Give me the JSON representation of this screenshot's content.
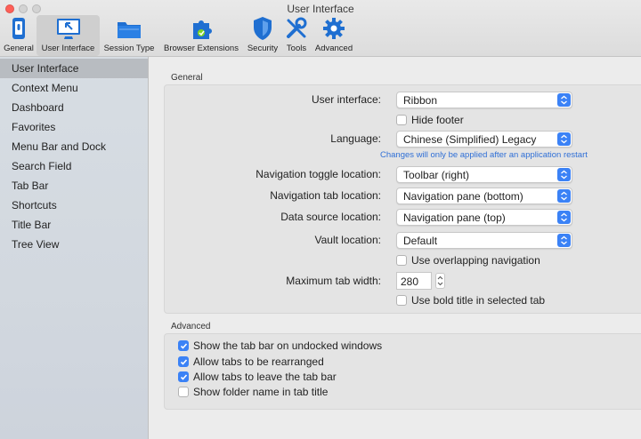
{
  "window": {
    "title": "User Interface"
  },
  "toolbar": {
    "items": [
      {
        "label": "General",
        "icon": "phone-switch-icon"
      },
      {
        "label": "User Interface",
        "icon": "window-cursor-icon",
        "selected": true
      },
      {
        "label": "Session Type",
        "icon": "folder-icon"
      },
      {
        "label": "Browser Extensions",
        "icon": "puzzle-icon"
      },
      {
        "label": "Security",
        "icon": "shield-icon"
      },
      {
        "label": "Tools",
        "icon": "tools-icon"
      },
      {
        "label": "Advanced",
        "icon": "gear-icon"
      }
    ]
  },
  "sidebar": {
    "items": [
      {
        "label": "User Interface",
        "selected": true
      },
      {
        "label": "Context Menu"
      },
      {
        "label": "Dashboard"
      },
      {
        "label": "Favorites"
      },
      {
        "label": "Menu Bar and Dock"
      },
      {
        "label": "Search Field"
      },
      {
        "label": "Tab Bar"
      },
      {
        "label": "Shortcuts"
      },
      {
        "label": "Title Bar"
      },
      {
        "label": "Tree View"
      }
    ]
  },
  "general": {
    "section_label": "General",
    "user_interface": {
      "label": "User interface:",
      "value": "Ribbon"
    },
    "hide_footer": {
      "label": "Hide footer",
      "checked": false
    },
    "language": {
      "label": "Language:",
      "value": "Chinese (Simplified) Legacy",
      "hint": "Changes will only be applied after an application restart"
    },
    "nav_toggle": {
      "label": "Navigation toggle location:",
      "value": "Toolbar (right)"
    },
    "nav_tab": {
      "label": "Navigation tab location:",
      "value": "Navigation pane (bottom)"
    },
    "data_source": {
      "label": "Data source location:",
      "value": "Navigation pane (top)"
    },
    "vault": {
      "label": "Vault location:",
      "value": "Default"
    },
    "overlapping_nav": {
      "label": "Use overlapping navigation",
      "checked": false
    },
    "max_tab_width": {
      "label": "Maximum tab width:",
      "value": "280"
    },
    "bold_title": {
      "label": "Use bold title in selected tab",
      "checked": false
    }
  },
  "advanced": {
    "section_label": "Advanced",
    "options": [
      {
        "label": "Show the tab bar on undocked windows",
        "checked": true
      },
      {
        "label": "Allow tabs to be rearranged",
        "checked": true
      },
      {
        "label": "Allow tabs to leave the tab bar",
        "checked": true
      },
      {
        "label": "Show folder name in tab title",
        "checked": false
      }
    ]
  },
  "colors": {
    "accent": "#3b82f6",
    "hint": "#2f6fd6",
    "close": "#fe5f57"
  }
}
